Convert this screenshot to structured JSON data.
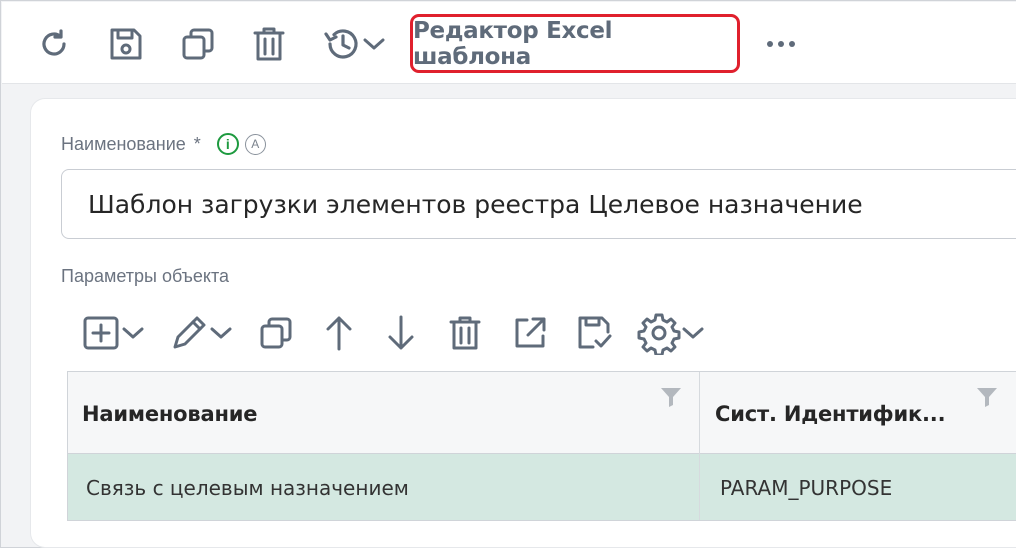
{
  "toolbar": {
    "editor_label": "Редактор Excel шаблона",
    "icons": [
      "refresh-icon",
      "save-icon",
      "copy-icon",
      "trash-icon",
      "history-icon",
      "more-icon"
    ]
  },
  "form": {
    "name_label": "Наименование",
    "required_mark": "*",
    "info_badge": "i",
    "auto_badge": "A",
    "name_value": "Шаблон загрузки элементов реестра Целевое назначение",
    "params_label": "Параметры объекта"
  },
  "grid": {
    "columns": [
      "Наименование",
      "Сист. Идентифик..."
    ],
    "rows": [
      [
        "Связь с целевым назначением",
        "PARAM_PURPOSE"
      ]
    ],
    "selected_row_color": "#d4e8e1"
  },
  "colors": {
    "accent_red": "#e0202d",
    "icon_gray": "#5f6b7a",
    "info_green": "#1d9a3f"
  }
}
